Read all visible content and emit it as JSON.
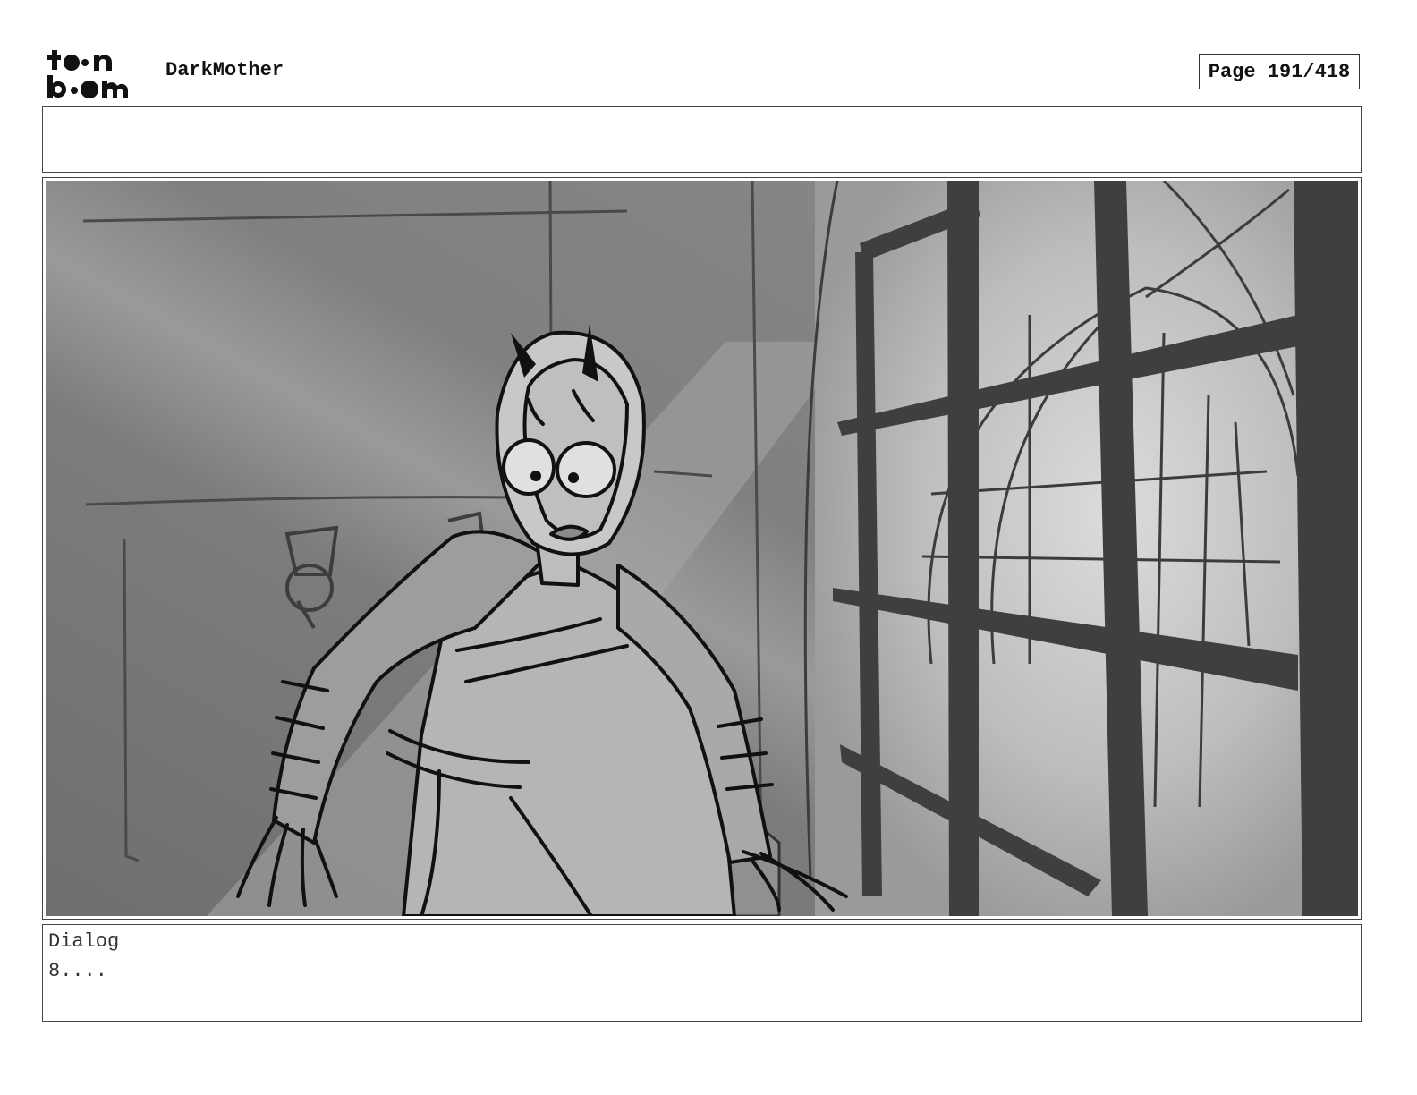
{
  "header": {
    "logo_line1": "toon",
    "logo_line2": "boom",
    "project_title": "DarkMother",
    "page_label": "Page 191/418"
  },
  "caption": {
    "text": ""
  },
  "panel": {
    "description_icon": "storyboard-sketch-horned-woman-by-barred-window"
  },
  "dialog": {
    "label": "Dialog",
    "text": "8...."
  },
  "colors": {
    "frame": "#444444",
    "bars": "#3f3f3f",
    "bg_dark": "#7a7a7a",
    "bg_light": "#b8b8b8"
  }
}
